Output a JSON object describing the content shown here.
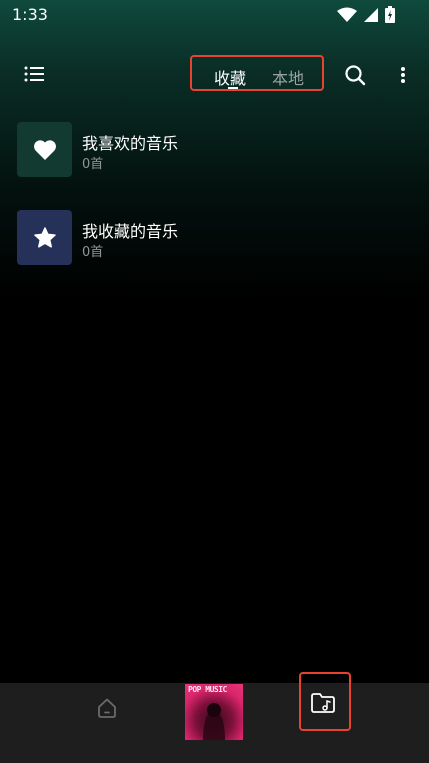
{
  "status_bar": {
    "time": "1:33",
    "icons": [
      "wifi-icon",
      "signal-icon",
      "battery-icon"
    ]
  },
  "header": {
    "tabs": [
      {
        "label": "收藏",
        "selected": true
      },
      {
        "label": "本地",
        "selected": false
      }
    ],
    "icons": [
      "menu-list-icon",
      "search-icon",
      "more-vertical-icon"
    ]
  },
  "playlists": [
    {
      "title": "我喜欢的音乐",
      "count": "0首",
      "icon": "heart-icon",
      "color": "#133a30"
    },
    {
      "title": "我收藏的音乐",
      "count": "0首",
      "icon": "star-icon",
      "color": "#26315a"
    }
  ],
  "bottom_nav": {
    "album_text": "POP MUSIC",
    "items": [
      "home-icon",
      "now-playing-album",
      "music-folder-icon"
    ]
  },
  "colors": {
    "accent_highlight": "#e8432f",
    "header_gradient_top": "#0f4a3d",
    "bottom_bar": "#1e1e1e"
  }
}
